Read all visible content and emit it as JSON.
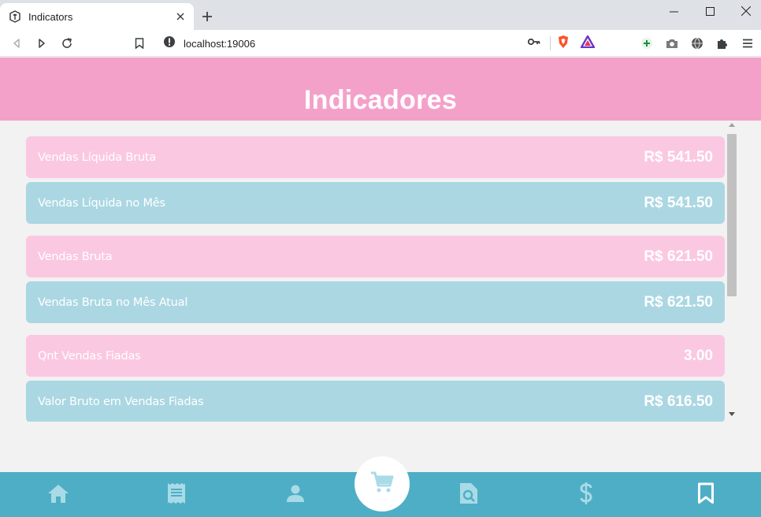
{
  "browser": {
    "tab_title": "Indicators",
    "url": "localhost:19006"
  },
  "app": {
    "title": "Indicadores",
    "header_color": "#f4a1ca",
    "nav_color": "#4eaec5"
  },
  "indicators": [
    {
      "label": "Vendas Líquida Bruta",
      "value": "R$ 541.50",
      "color": "pink"
    },
    {
      "label": "Vendas Líquida no Mês",
      "value": "R$ 541.50",
      "color": "blue"
    },
    {
      "label": "Vendas Bruta",
      "value": "R$ 621.50",
      "color": "pink"
    },
    {
      "label": "Vendas Bruta no Mês Atual",
      "value": "R$ 621.50",
      "color": "blue"
    },
    {
      "label": "Qnt Vendas Fiadas",
      "value": "3.00",
      "color": "pink"
    },
    {
      "label": "Valor Bruto em Vendas Fiadas",
      "value": "R$ 616.50",
      "color": "blue"
    }
  ],
  "bottom_nav": [
    {
      "icon": "home-icon"
    },
    {
      "icon": "receipt-icon"
    },
    {
      "icon": "person-icon"
    },
    {
      "icon": "cart-icon"
    },
    {
      "icon": "document-search-icon"
    },
    {
      "icon": "dollar-icon"
    },
    {
      "icon": "bookmark-icon"
    }
  ]
}
